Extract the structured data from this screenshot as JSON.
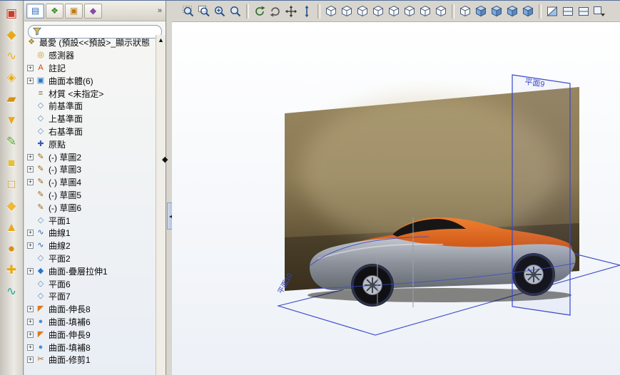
{
  "glyphs": {
    "scroll_up": "▲",
    "splitter_handle": "◆",
    "collapse_arrow": "◂",
    "chevron": "»",
    "expander": "+"
  },
  "side_toolbar": {
    "icons": [
      {
        "name": "extruded-surface-tool",
        "glyph": "▣",
        "color": "#c83c28"
      },
      {
        "name": "revolved-surface-tool",
        "glyph": "◆",
        "color": "#e8a818"
      },
      {
        "name": "swept-surface-tool",
        "glyph": "∿",
        "color": "#e8a818"
      },
      {
        "name": "lofted-surface-tool",
        "glyph": "◈",
        "color": "#e8a818"
      },
      {
        "name": "boundary-surface-tool",
        "glyph": "▰",
        "color": "#d89010"
      },
      {
        "name": "filled-surface-tool",
        "glyph": "▼",
        "color": "#e8a818"
      },
      {
        "name": "freeform-tool",
        "glyph": "✎",
        "color": "#58a028"
      },
      {
        "name": "planar-surface-tool",
        "glyph": "■",
        "color": "#e8c030"
      },
      {
        "name": "offset-surface-tool",
        "glyph": "□",
        "color": "#d89010"
      },
      {
        "name": "ruled-surface-tool",
        "glyph": "◆",
        "color": "#f0b838"
      },
      {
        "name": "extend-surface-tool",
        "glyph": "▲",
        "color": "#e8a818"
      },
      {
        "name": "delete-face-tool",
        "glyph": "●",
        "color": "#d89010"
      },
      {
        "name": "trim-surface-tool",
        "glyph": "✚",
        "color": "#e8a818"
      },
      {
        "name": "knit-surface-tool",
        "glyph": "∿",
        "color": "#18a090"
      }
    ]
  },
  "tree": {
    "tabs": [
      {
        "name": "featuremanager",
        "glyph": "▤",
        "color": "#2868b8",
        "active": true
      },
      {
        "name": "propertymanager",
        "glyph": "❖",
        "color": "#38882a",
        "active": false
      },
      {
        "name": "configurationmanager",
        "glyph": "▣",
        "color": "#c07818",
        "active": false
      },
      {
        "name": "dimxpertmanager",
        "glyph": "◆",
        "color": "#8848a8",
        "active": false
      }
    ],
    "chevron": "»",
    "filter_placeholder": "",
    "icon_glyphs": {
      "config": {
        "glyph": "❖",
        "color": "#b08020"
      },
      "sensor": {
        "glyph": "◎",
        "color": "#c09020"
      },
      "annotation": {
        "glyph": "A",
        "color": "#d04010"
      },
      "surface-folder": {
        "glyph": "▣",
        "color": "#2878c8"
      },
      "material": {
        "glyph": "≡",
        "color": "#807050"
      },
      "plane": {
        "glyph": "◇",
        "color": "#6888b8"
      },
      "origin": {
        "glyph": "✚",
        "color": "#3858c0"
      },
      "sketch": {
        "glyph": "✎",
        "color": "#a06818"
      },
      "curve": {
        "glyph": "∿",
        "color": "#3060b0"
      },
      "surface-loft": {
        "glyph": "◆",
        "color": "#2878c8"
      },
      "surface-extrude": {
        "glyph": "◤",
        "color": "#e07820"
      },
      "surface-fill": {
        "glyph": "●",
        "color": "#4890d8"
      },
      "surface-trim": {
        "glyph": "✂",
        "color": "#b06010"
      }
    },
    "items": [
      {
        "label": "最愛 (預設<<預設>_顯示狀態",
        "icon": "config",
        "expand": false,
        "root": true
      },
      {
        "label": "感測器",
        "icon": "sensor",
        "expand": false
      },
      {
        "label": "註記",
        "icon": "annotation",
        "expand": true
      },
      {
        "label": "曲面本體(6)",
        "icon": "surface-folder",
        "expand": true
      },
      {
        "label": "材質 <未指定>",
        "icon": "material",
        "expand": false
      },
      {
        "label": "前基準面",
        "icon": "plane",
        "expand": false
      },
      {
        "label": "上基準面",
        "icon": "plane",
        "expand": false
      },
      {
        "label": "右基準面",
        "icon": "plane",
        "expand": false
      },
      {
        "label": "原點",
        "icon": "origin",
        "expand": false
      },
      {
        "label": "(-) 草圖2",
        "icon": "sketch",
        "expand": true
      },
      {
        "label": "(-) 草圖3",
        "icon": "sketch",
        "expand": true
      },
      {
        "label": "(-) 草圖4",
        "icon": "sketch",
        "expand": true
      },
      {
        "label": "(-) 草圖5",
        "icon": "sketch",
        "expand": false
      },
      {
        "label": "(-) 草圖6",
        "icon": "sketch",
        "expand": false
      },
      {
        "label": "平面1",
        "icon": "plane",
        "expand": false
      },
      {
        "label": "曲線1",
        "icon": "curve",
        "expand": true
      },
      {
        "label": "曲線2",
        "icon": "curve",
        "expand": true
      },
      {
        "label": "平面2",
        "icon": "plane",
        "expand": false
      },
      {
        "label": "曲面-疊層拉伸1",
        "icon": "surface-loft",
        "expand": true
      },
      {
        "label": "平面6",
        "icon": "plane",
        "expand": false
      },
      {
        "label": "平面7",
        "icon": "plane",
        "expand": false
      },
      {
        "label": "曲面-伸長8",
        "icon": "surface-extrude",
        "expand": true
      },
      {
        "label": "曲面-填補6",
        "icon": "surface-fill",
        "expand": true
      },
      {
        "label": "曲面-伸長9",
        "icon": "surface-extrude",
        "expand": true
      },
      {
        "label": "曲面-填補8",
        "icon": "surface-fill",
        "expand": true
      },
      {
        "label": "曲面-修剪1",
        "icon": "surface-trim",
        "expand": true
      }
    ]
  },
  "view_toolbar": {
    "icons": [
      {
        "name": "zoom-to-fit",
        "type": "magnifier-fit"
      },
      {
        "name": "zoom-to-area",
        "type": "magnifier-area"
      },
      {
        "name": "zoom-in-out",
        "type": "magnifier-plus"
      },
      {
        "name": "zoom-to-selection",
        "type": "magnifier"
      },
      {
        "type": "sep"
      },
      {
        "name": "rotate-view",
        "type": "rotate"
      },
      {
        "name": "roll-view",
        "type": "rotate2"
      },
      {
        "name": "pan",
        "type": "pan"
      },
      {
        "name": "move-z",
        "type": "updown"
      },
      {
        "type": "sep"
      },
      {
        "name": "view-front",
        "type": "cube"
      },
      {
        "name": "view-back",
        "type": "cube"
      },
      {
        "name": "view-left",
        "type": "cube"
      },
      {
        "name": "view-right",
        "type": "cube"
      },
      {
        "name": "view-top",
        "type": "cube"
      },
      {
        "name": "view-bottom",
        "type": "cube"
      },
      {
        "name": "view-isometric",
        "type": "cube"
      },
      {
        "name": "view-trimetric",
        "type": "cube"
      },
      {
        "type": "sep"
      },
      {
        "name": "display-wireframe",
        "type": "cube"
      },
      {
        "name": "display-hidden-lines-visible",
        "type": "cube-shaded"
      },
      {
        "name": "display-hidden-lines-removed",
        "type": "cube-shaded"
      },
      {
        "name": "display-shaded-with-edges",
        "type": "cube-shaded"
      },
      {
        "name": "display-shaded",
        "type": "cube-shaded"
      },
      {
        "type": "sep"
      },
      {
        "name": "section-view",
        "type": "section"
      },
      {
        "name": "view-orientation",
        "type": "flat"
      },
      {
        "name": "camera-view",
        "type": "flat"
      },
      {
        "name": "display-settings",
        "type": "flat-dd"
      }
    ]
  },
  "viewport": {
    "plane_label_vertical": "平面9",
    "plane_label_bottom": "平面10",
    "colors": {
      "plane_blue": "#3b49c8",
      "car_body_gray": "#8a8f99",
      "car_top_orange": "#e06820",
      "backdrop_brown": "#8a7954"
    }
  }
}
